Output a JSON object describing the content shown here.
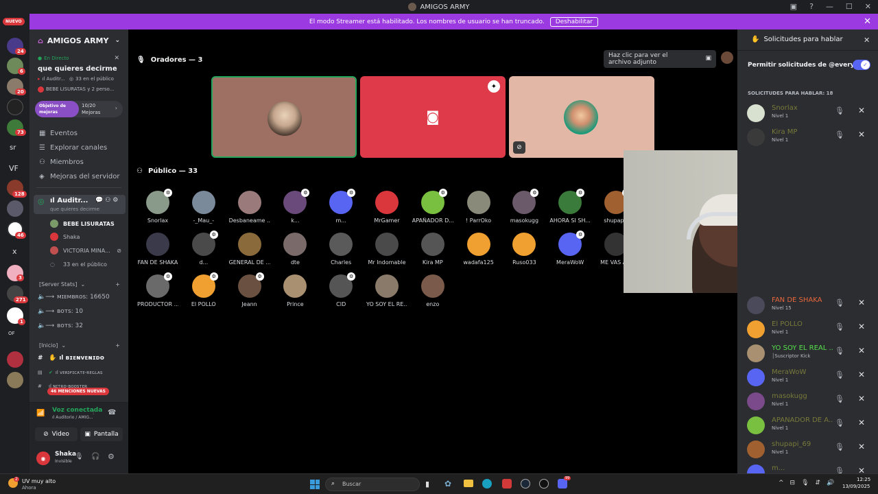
{
  "window": {
    "title": "AMIGOS ARMY"
  },
  "banner": {
    "text": "El modo Streamer está habilitado. Los nombres de usuario se han truncado.",
    "button": "Deshabilitar"
  },
  "rail": {
    "new_label": "NUEVO",
    "badges": [
      "24",
      "6",
      "20",
      "73",
      "128",
      "46",
      "3",
      "271",
      "1"
    ],
    "text_servers": [
      "sr",
      "VF",
      "x",
      "OF"
    ]
  },
  "sidebar": {
    "server_name": "AMIGOS ARMY",
    "live_label": "En Directo",
    "event_title": "que quieres decirme",
    "event_channel": "ıl Auditr...",
    "event_audience": "33 en el público",
    "event_speakers": "BEBE LISURATAS y 2 perso...",
    "goal_label": "Objetivo de mejoras",
    "goal_count": "10/20",
    "goal_unit": "Mejoras",
    "goal_progress": 0.5,
    "nav": [
      "Eventos",
      "Explorar canales",
      "Miembros",
      "Mejoras del servidor"
    ],
    "voice_channel": "ıl Auditr...",
    "voice_topic": "que quieres decirme",
    "voice_users": [
      "BEBE LISURATAS",
      "Shaka",
      "VICTORIA MINA...",
      "33 en el público"
    ],
    "stats_category": "[Server Stats]",
    "stats": [
      "ᴍɪᴇᴍʙʀᴏs: 16650",
      "ʙᴏᴛs: 10",
      "ʙᴏᴛs: 32"
    ],
    "inicio_category": "[Inicio]",
    "channels": [
      "ıl ʙɪᴇɴᴠᴇɴɪᴅᴏ",
      "ıl ᴠᴇʀɪғɪᴄᴀᴛᴇ-ʀᴇɢʟᴀs",
      "ıl ɴɪᴛʀᴏ-ʙᴏᴏsᴛᴇʀ"
    ],
    "mentions_pill": "46 MENCIONES NUEVAS",
    "voice_connected": "Voz conectada",
    "voice_connected_sub": "ıl Auditorio / AMIG...",
    "video_btn": "Video",
    "screen_btn": "Pantalla",
    "user_name": "Shaka",
    "user_status": "Invisible"
  },
  "stage": {
    "speakers_title": "Oradores — 3",
    "attachment_tip": "Haz clic para ver el archivo adjunto",
    "public_title": "Público — 33",
    "audience": [
      "Snorlax",
      "-_Mau_-",
      "Desbaneame ...",
      "k...",
      "m...",
      "MrGamer",
      "APAÑADOR D...",
      "! ParrOko",
      "masokugg",
      "AHORA SI SH...",
      "shupapi_",
      "FAN DE SHAKA",
      "d...",
      "GENERAL DE ...",
      "dte",
      "Charles",
      "Mr Indomable",
      "Kira MP",
      "wadafa125",
      "Ruso033",
      "MeraWoW",
      "ME VAS A S",
      "PRODUCTOR ...",
      "El POLLO",
      "Jeann",
      "Prince",
      "CID",
      "YO SOY EL RE...",
      "enzo"
    ]
  },
  "panel": {
    "title": "Solicitudes para hablar",
    "allow_label": "Permitir solicitudes de @everyone",
    "allow_enabled": true,
    "requests_header": "SOLICITUDES PARA HABLAR: 18",
    "requests": [
      {
        "name": "Snorlax",
        "level": "Nivel 1",
        "color": "#7a7a3a"
      },
      {
        "name": "Kira MP",
        "level": "Nivel 1",
        "color": "#7a7a3a"
      },
      {
        "name": "FAN DE SHAKA",
        "level": "Nivel 15",
        "color": "#e8673c"
      },
      {
        "name": "El POLLO",
        "level": "Nivel 1",
        "color": "#7a7a3a"
      },
      {
        "name": "YO SOY EL REAL ...",
        "level": "│Suscriptor Kick",
        "color": "#55e04a"
      },
      {
        "name": "MeraWoW",
        "level": "Nivel 1",
        "color": "#7a7a3a"
      },
      {
        "name": "masokugg",
        "level": "Nivel 1",
        "color": "#7a7a3a"
      },
      {
        "name": "APAÑADOR DE A...",
        "level": "Nivel 1",
        "color": "#7a7a3a"
      },
      {
        "name": "shupapi_69",
        "level": "Nivel 1",
        "color": "#7a7a3a"
      },
      {
        "name": "m...",
        "level": "",
        "color": "#7a7a3a"
      }
    ]
  },
  "taskbar": {
    "weather": "UV muy alto",
    "weather_sub": "Ahora",
    "weather_badge": "2",
    "search": "Buscar",
    "time": "12:25",
    "date": "13/09/2025",
    "discord_badge": "99"
  },
  "colors": {
    "accent": "#5865f2",
    "banner": "#9b3ae0",
    "red": "#da373c",
    "green": "#23a55a"
  }
}
